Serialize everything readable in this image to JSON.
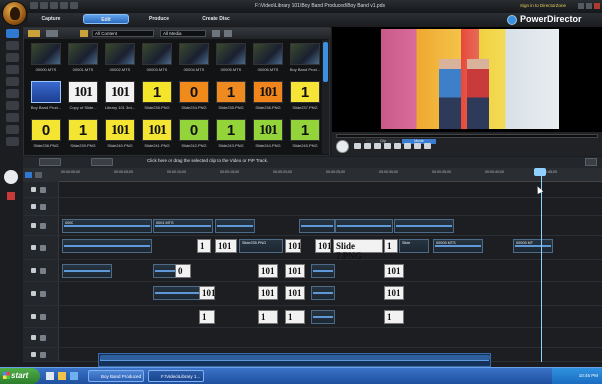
{
  "window": {
    "title": "F:\\Video\\Library 101\\Boy Band Produced\\Boy Band v1.pds",
    "signin": "Sign in to DirectorZone",
    "brand": "PowerDirector"
  },
  "modes": [
    "Capture",
    "Edit",
    "Produce",
    "Create Disc"
  ],
  "library": {
    "filter1": "All Content",
    "filter2": "All Media",
    "items": [
      {
        "label": "00000.MTS",
        "kind": "video"
      },
      {
        "label": "00001.MTS",
        "kind": "video"
      },
      {
        "label": "00002.MTS",
        "kind": "video"
      },
      {
        "label": "00003.MTS",
        "kind": "video"
      },
      {
        "label": "00004.MTS",
        "kind": "video"
      },
      {
        "label": "00005.MTS",
        "kind": "video"
      },
      {
        "label": "00006.MTS",
        "kind": "video"
      },
      {
        "label": "Boy Band Prod...",
        "kind": "video"
      },
      {
        "label": "Boy Band Prod...",
        "kind": "video"
      },
      {
        "label": "Copy of Slide...",
        "kind": "101"
      },
      {
        "label": "Library 101 3rd...",
        "kind": "101"
      },
      {
        "label": "Slide235.PNG",
        "kind": "1",
        "bg": "#f5e52a"
      },
      {
        "label": "Slide234.PNG",
        "kind": "0",
        "bg": "#f08a1a"
      },
      {
        "label": "Slide235.PNG",
        "kind": "1",
        "bg": "#ee8a1f"
      },
      {
        "label": "Slide236.PNG",
        "kind": "101",
        "bg": "#f0861b"
      },
      {
        "label": "Slide237.PNG",
        "kind": "1",
        "bg": "#f6e436"
      },
      {
        "label": "Slide238.PNG",
        "kind": "0",
        "bg": "#f3e531"
      },
      {
        "label": "Slide239.PNG",
        "kind": "1",
        "bg": "#f3e531"
      },
      {
        "label": "Slide240.PNG",
        "kind": "101",
        "bg": "#f3e531"
      },
      {
        "label": "Slide241.PNG",
        "kind": "101",
        "bg": "#f3e531"
      },
      {
        "label": "Slide242.PNG",
        "kind": "0",
        "bg": "#93d43a"
      },
      {
        "label": "Slide243.PNG",
        "kind": "1",
        "bg": "#93d43a"
      },
      {
        "label": "Slide244.PNG",
        "kind": "101",
        "bg": "#93d43a"
      },
      {
        "label": "Slide245.PNG",
        "kind": "1",
        "bg": "#93d43a"
      }
    ]
  },
  "preview": {
    "tab1": "Clip",
    "tab2": "Movie"
  },
  "midbar": {
    "message": "Click here or drag the selected clip to the Video or PiP Track."
  },
  "ruler": [
    "00:00:00;00",
    "00:00:05;00",
    "00:00:10;00",
    "00:00:15;00",
    "00:00:20;00",
    "00:00:25;00",
    "00:00:30;00",
    "00:00:35;00",
    "00:00:40;00",
    "00:00:45;00"
  ],
  "clips": {
    "c1": "0000",
    "c2": "0001 MTS",
    "c3": "Slide235.PNG",
    "c4": "Slide 7.PNG",
    "c5": "00005 MTS",
    "c6": "Slide",
    "c7": "00006",
    "c8": "00005 MT",
    "c9": "101",
    "c10": "1",
    "c11": "0",
    "audio": "Library 101 3rd Draft with Intro.mp3"
  },
  "taskbar": {
    "start": "start",
    "task1": "Boy Band Produced",
    "task2": "F:\\Video\\Library 1...",
    "clock": "10:45 PM"
  }
}
